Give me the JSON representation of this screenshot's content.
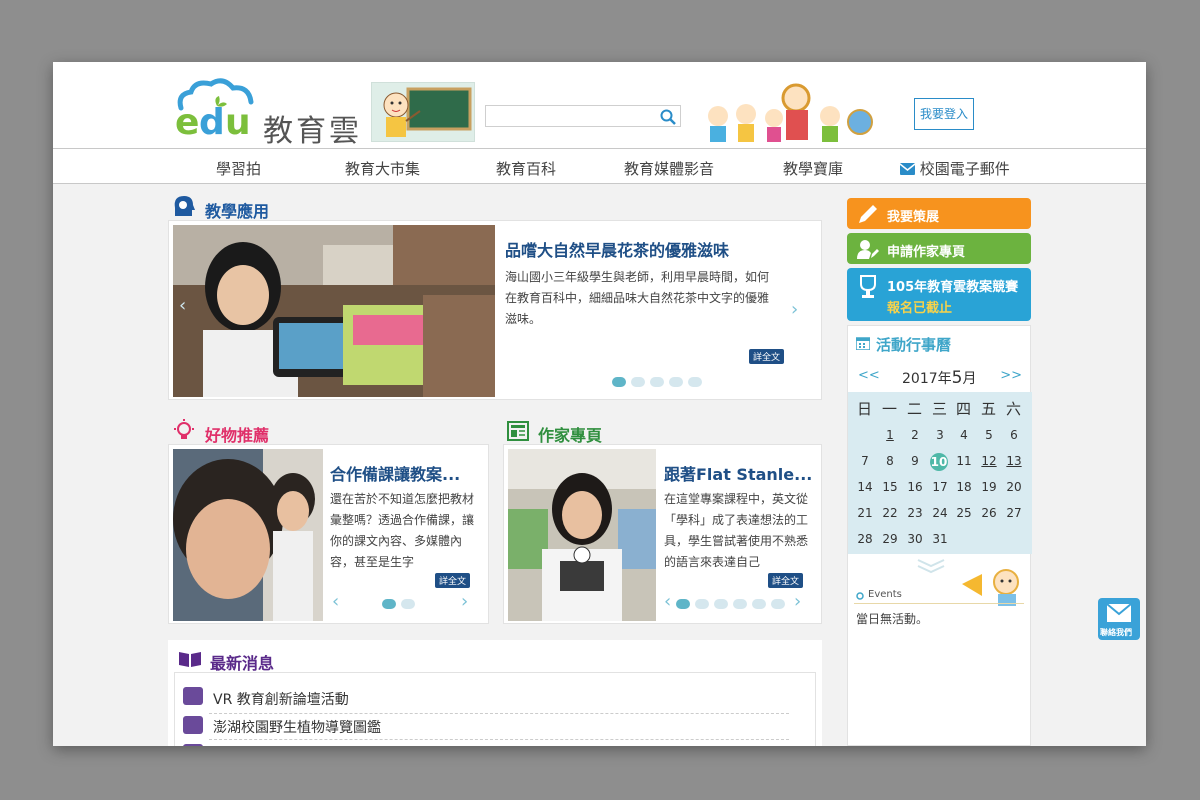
{
  "header": {
    "logo_text": "教育雲",
    "logo_mark": "edu",
    "search": {
      "placeholder": "",
      "value": ""
    },
    "login_label": "我要登入"
  },
  "nav": {
    "items": [
      "學習拍",
      "教育大市集",
      "教育百科",
      "教育媒體影音",
      "教學寶庫",
      "校園電子郵件"
    ]
  },
  "teaching_apps": {
    "title": "教學應用",
    "headline": "品嚐大自然早晨花茶的優雅滋味",
    "description": "海山國小三年級學生與老師，利用早晨時間，如何在教育百科中，細細品味大自然花茶中文字的優雅滋味。",
    "detail_label": "詳全文"
  },
  "good_items": {
    "title": "好物推薦",
    "headline": "合作備課讓教案...",
    "description": "還在苦於不知道怎麼把教材彙整嗎？透過合作備課，讓你的課文內容、多媒體內容，甚至是生字",
    "detail_label": "詳全文"
  },
  "writer_page": {
    "title": "作家專頁",
    "headline": "跟著Flat Stanle...",
    "description": "在這堂專案課程中，英文從「學科」成了表達想法的工具，學生嘗試著使用不熟悉的語言來表達自己",
    "detail_label": "詳全文"
  },
  "news": {
    "title": "最新消息",
    "items": [
      "VR 教育創新論壇活動",
      "澎湖校園野生植物導覽圖鑑"
    ]
  },
  "sidebar": {
    "btn_expo": "我要策展",
    "btn_writer": "申請作家專頁",
    "btn_contest": "105年教育雲教案競賽",
    "contest_status": "報名已截止",
    "calendar_title": "活動行事曆",
    "prev": "<<",
    "next": ">>",
    "year_label": "2017年",
    "month": "5",
    "month_suffix": "月",
    "weekdays": [
      "日",
      "一",
      "二",
      "三",
      "四",
      "五",
      "六"
    ],
    "events_label": "Events",
    "no_event": "當日無活動。",
    "contact_label": "聯絡我們"
  },
  "colors": {
    "orange": "#f7931e",
    "green": "#6cb33f",
    "blue": "#29a3d6",
    "contest_status": "#f7d24a"
  }
}
